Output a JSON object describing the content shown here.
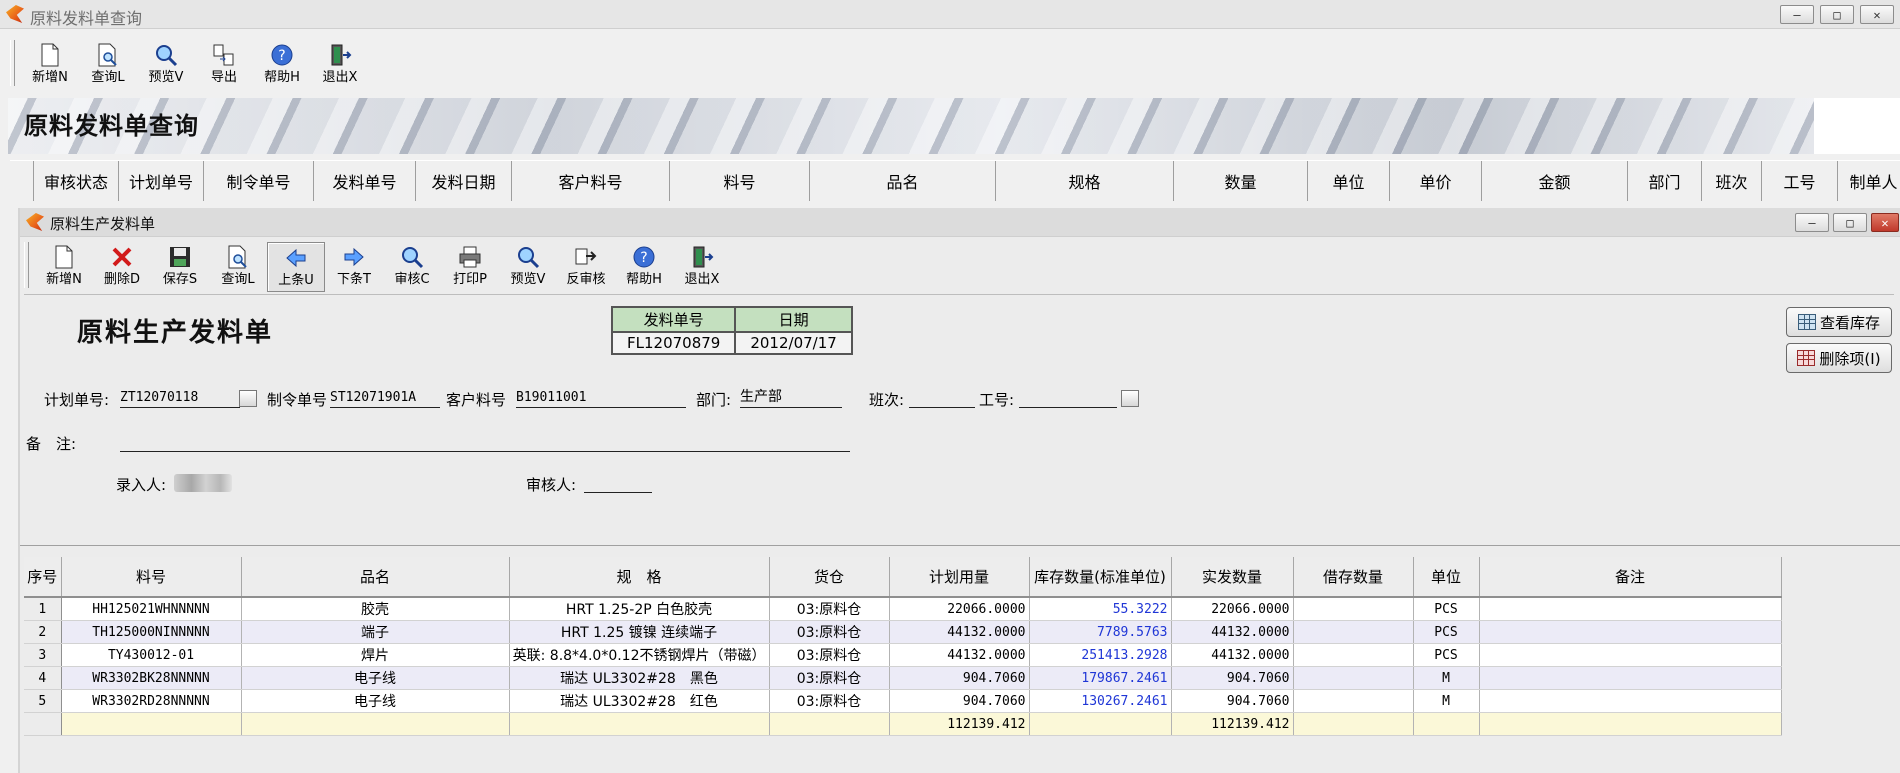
{
  "outer_window": {
    "title": "原料发料单查询",
    "toolbar": [
      {
        "name": "new",
        "label": "新增N",
        "icon": "new-document-icon"
      },
      {
        "name": "query",
        "label": "查询L",
        "icon": "query-document-icon"
      },
      {
        "name": "preview",
        "label": "预览V",
        "icon": "magnifier-icon"
      },
      {
        "name": "export",
        "label": "导出",
        "icon": "export-icon"
      },
      {
        "name": "help",
        "label": "帮助H",
        "icon": "help-icon"
      },
      {
        "name": "exit",
        "label": "退出X",
        "icon": "exit-door-icon"
      }
    ],
    "banner_title": "原料发料单查询",
    "columns": [
      "审核状态",
      "计划单号",
      "制令单号",
      "发料单号",
      "发料日期",
      "客户料号",
      "料号",
      "品名",
      "规格",
      "数量",
      "单位",
      "单价",
      "金额",
      "部门",
      "班次",
      "工号",
      "制单人"
    ]
  },
  "inner_window": {
    "title": "原料生产发料单",
    "toolbar": [
      {
        "name": "new",
        "label": "新增N",
        "icon": "new-document-icon"
      },
      {
        "name": "delete",
        "label": "删除D",
        "icon": "delete-x-icon"
      },
      {
        "name": "save",
        "label": "保存S",
        "icon": "save-disk-icon"
      },
      {
        "name": "query",
        "label": "查询L",
        "icon": "query-document-icon"
      },
      {
        "name": "prev",
        "label": "上条U",
        "icon": "arrow-left-icon"
      },
      {
        "name": "next",
        "label": "下条T",
        "icon": "arrow-right-icon"
      },
      {
        "name": "audit",
        "label": "审核C",
        "icon": "magnifier-icon"
      },
      {
        "name": "print",
        "label": "打印P",
        "icon": "printer-icon"
      },
      {
        "name": "preview",
        "label": "预览V",
        "icon": "magnifier-icon"
      },
      {
        "name": "unaudit",
        "label": "反审核",
        "icon": "unaudit-icon"
      },
      {
        "name": "help",
        "label": "帮助H",
        "icon": "help-icon"
      },
      {
        "name": "exit",
        "label": "退出X",
        "icon": "exit-door-icon"
      }
    ],
    "form_title": "原料生产发料单",
    "issue_box": {
      "number_label": "发料单号",
      "date_label": "日期",
      "number": "FL12070879",
      "date": "2012/07/17"
    },
    "side_buttons": {
      "view_stock": "查看库存",
      "delete_item": "删除项(I)"
    },
    "fields": {
      "plan_no_label": "计划单号:",
      "plan_no": "ZT12070118",
      "order_no_label": "制令单号",
      "order_no": "ST12071901A",
      "cust_part_label": "客户料号",
      "cust_part": "B19011001",
      "dept_label": "部门:",
      "dept": "生产部",
      "shift_label": "班次:",
      "shift": "",
      "emp_label": "工号:",
      "emp": "",
      "remark_label": "备　注:",
      "remark": "",
      "entered_by_label": "录入人:",
      "auditor_label": "审核人:",
      "auditor": ""
    },
    "grid": {
      "headers": [
        "序号",
        "料号",
        "品名",
        "规　格",
        "货仓",
        "计划用量",
        "库存数量(标准单位)",
        "实发数量",
        "借存数量",
        "单位",
        "备注"
      ],
      "rows": [
        {
          "seq": "1",
          "part": "HH125021WHNNNNN",
          "name": "胶壳",
          "spec": "HRT 1.25-2P 白色胶壳",
          "wh": "03:原料仓",
          "plan": "22066.0000",
          "stock": "55.3222",
          "actual": "22066.0000",
          "borrow": "",
          "unit": "PCS",
          "note": ""
        },
        {
          "seq": "2",
          "part": "TH125000NINNNNN",
          "name": "端子",
          "spec": "HRT 1.25 镀镍 连续端子",
          "wh": "03:原料仓",
          "plan": "44132.0000",
          "stock": "7789.5763",
          "actual": "44132.0000",
          "borrow": "",
          "unit": "PCS",
          "note": ""
        },
        {
          "seq": "3",
          "part": "TY430012-01",
          "name": "焊片",
          "spec": "英联: 8.8*4.0*0.12不锈钢焊片（带磁）",
          "wh": "03:原料仓",
          "plan": "44132.0000",
          "stock": "251413.2928",
          "actual": "44132.0000",
          "borrow": "",
          "unit": "PCS",
          "note": ""
        },
        {
          "seq": "4",
          "part": "WR3302BK28NNNNN",
          "name": "电子线",
          "spec": "瑞达 UL3302#28　黑色",
          "wh": "03:原料仓",
          "plan": "904.7060",
          "stock": "179867.2461",
          "actual": "904.7060",
          "borrow": "",
          "unit": "M",
          "note": ""
        },
        {
          "seq": "5",
          "part": "WR3302RD28NNNNN",
          "name": "电子线",
          "spec": "瑞达 UL3302#28　红色",
          "wh": "03:原料仓",
          "plan": "904.7060",
          "stock": "130267.2461",
          "actual": "904.7060",
          "borrow": "",
          "unit": "M",
          "note": ""
        }
      ],
      "totals": {
        "plan": "112139.412",
        "actual": "112139.412"
      }
    }
  }
}
